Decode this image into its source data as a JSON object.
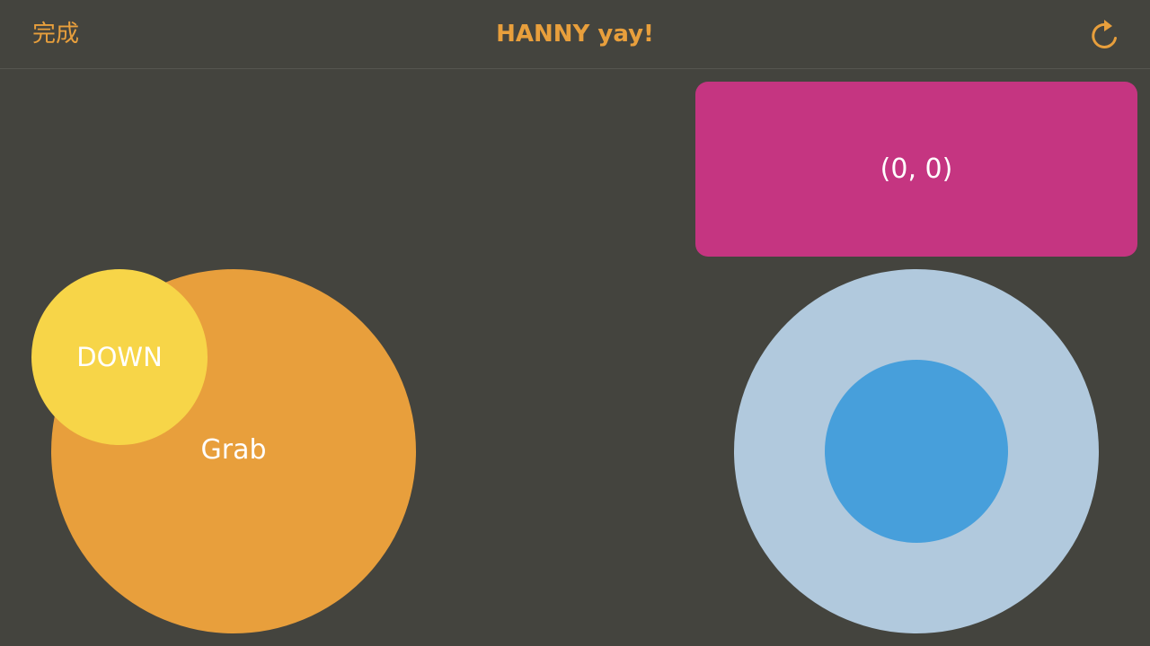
{
  "navbar": {
    "done_label": "完成",
    "title": "HANNY yay!",
    "refresh_icon": "refresh-icon"
  },
  "coord_panel": {
    "text": "(0, 0)"
  },
  "grab_button": {
    "label": "Grab"
  },
  "down_button": {
    "label": "DOWN"
  },
  "joystick": {
    "position_readout": "(0, 0)"
  },
  "colors": {
    "background": "#44443e",
    "accent": "#e89f3c",
    "coord_panel": "#c53581",
    "grab": "#e89f3c",
    "down": "#f7d548",
    "joystick_base": "#b1c9dd",
    "joystick_knob": "#479fdb"
  }
}
